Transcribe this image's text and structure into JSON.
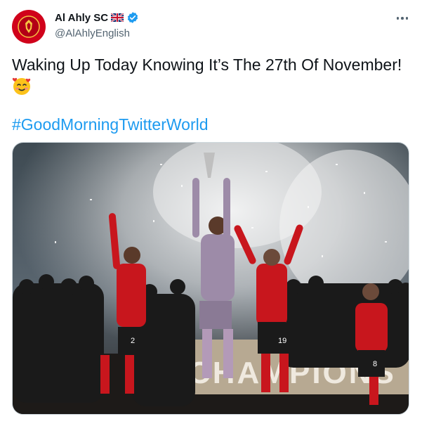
{
  "account": {
    "display_name": "Al Ahly SC",
    "handle": "@AlAhlyEnglish",
    "flag_icon": "uk-flag-icon",
    "verified_icon": "verified-badge-icon"
  },
  "tweet": {
    "text": "Waking Up Today Knowing It’s The 27th Of November!",
    "emoji": "smiling-face-with-hearts-emoji",
    "hashtag": "#GoodMorningTwitterWorld"
  },
  "media": {
    "banner_text": "CHAMPIONS",
    "shorts_numbers": [
      "2",
      "19",
      "8"
    ]
  },
  "colors": {
    "brand_red": "#d0021b",
    "link_blue": "#1d9bf0",
    "text_primary": "#0f1419",
    "text_secondary": "#536471"
  }
}
